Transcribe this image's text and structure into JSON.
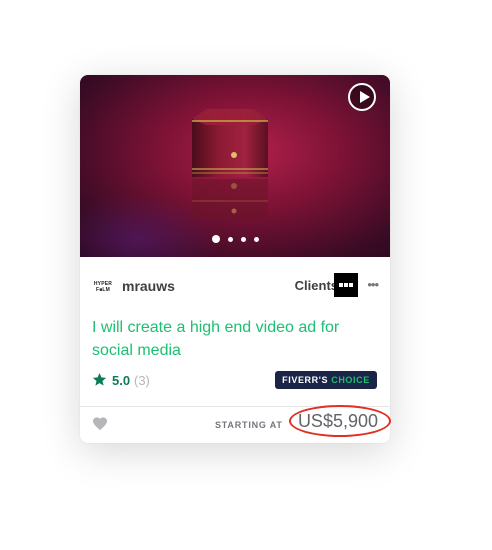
{
  "media": {
    "slides_total": 4,
    "active_slide": 1
  },
  "seller": {
    "name": "mrauws",
    "logo_line1": "HYPER",
    "logo_line2": "F■LM",
    "clients_label": "Clients"
  },
  "gig": {
    "title": "I will create a high end video ad for social media"
  },
  "rating": {
    "value": "5.0",
    "count": "(3)"
  },
  "badge": {
    "part1": "FIVERR'S",
    "part2": "CHOICE"
  },
  "footer": {
    "starting_label": "STARTING AT",
    "price": "US$5,900"
  },
  "colors": {
    "accent": "#1dbf73",
    "badge_bg": "#1b2548",
    "annotation": "#e03024"
  },
  "icons": [
    "play-icon",
    "more-icon",
    "star-icon",
    "heart-icon"
  ]
}
